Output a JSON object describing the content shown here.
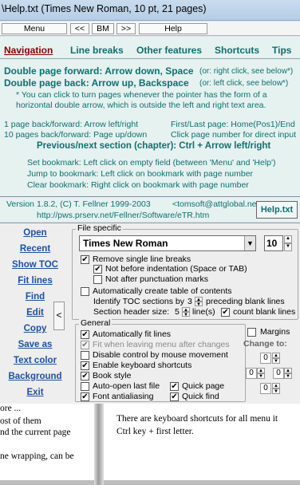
{
  "title": "\\Help.txt (Times New Roman, 10 pt, 21 pages)",
  "menubar": {
    "menu": "Menu",
    "back_back": "<<",
    "bm": "BM",
    "fwd_fwd": ">>",
    "help": "Help"
  },
  "help_tabs": [
    "Navigation",
    "Line breaks",
    "Other features",
    "Shortcuts",
    "Tips"
  ],
  "help": {
    "line1_main": "Double page forward: Arrow down, Space",
    "line1_note": "(or: right click, see below*)",
    "line2_main": "Double page back: Arrow up, Backspace",
    "line2_note": "(or: left click, see below*)",
    "star1": "* You can click to turn pages whenever the pointer has the form of a",
    "star2": "horizontal double arrow, which is outside the left and right text area.",
    "nav_l1": "1 page back/forward: Arrow left/right",
    "nav_r1": "First/Last page: Home(Pos1)/End",
    "nav_l2": "10 pages back/forward: Page up/down",
    "nav_r2": "Click page number for direct input",
    "section": "Previous/next section (chapter): Ctrl + Arrow left/right",
    "bm1": "Set bookmark: Left click on empty field (between 'Menu' and 'Help')",
    "bm2": "Jump to bookmark: Left click on bookmark with page number",
    "bm3": "Clear bookmark: Right click on bookmark with page number"
  },
  "version": {
    "line1": "Version 1.8.2, (C) T. Fellner 1999-2003",
    "email": "<tomsoft@attglobal.net>",
    "url": "http://pws.prserv.net/Fellner/Software/eTR.htm",
    "help_button": "Help.txt"
  },
  "left_menu": [
    "Open",
    "Recent",
    "Show TOC",
    "Fit lines",
    "Find",
    "Edit",
    "Copy",
    "Save as",
    "Text color",
    "Background",
    "Exit"
  ],
  "collapse_glyph": "<",
  "file_specific": {
    "title": "File specific",
    "font": "Times New Roman",
    "size": "10",
    "remove_single": "Remove single line breaks",
    "not_before_indent": "Not before indentation (Space or TAB)",
    "not_after_punct": "Not after punctuation marks",
    "auto_toc": "Automatically create table of contents",
    "identify_pre": "Identify TOC sections by",
    "identify_val": "3",
    "identify_post": "preceding blank lines",
    "header_pre": "Section header size:",
    "header_val": "5",
    "header_post": "line(s)",
    "count_blank": "count blank lines"
  },
  "general": {
    "title": "General",
    "auto_fit": "Automatically fit lines",
    "fit_when_leaving": "Fit when leaving menu after changes",
    "disable_mouse": "Disable control by mouse movement",
    "enable_kbd": "Enable keyboard shortcuts",
    "book_style": "Book style",
    "auto_open": "Auto-open last file",
    "font_aa": "Font antialiasing",
    "quick_page": "Quick page",
    "quick_find": "Quick find",
    "margins": "Margins",
    "change_to": "Change to:",
    "margin_top": "0",
    "margin_left": "0",
    "margin_right": "0",
    "margin_bottom": "0"
  },
  "doc_left": [
    "ore ...",
    "ost of them",
    "nd the current page",
    "",
    "ne wrapping, can be"
  ],
  "doc_right": [
    "There are keyboard shortcuts for all menu it",
    "Ctrl key + first letter."
  ]
}
